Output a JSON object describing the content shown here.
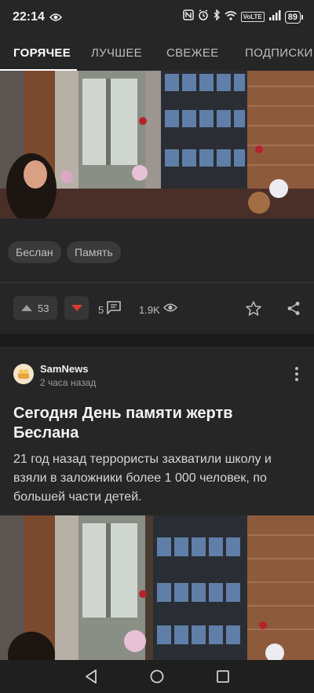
{
  "status": {
    "time": "22:14",
    "volte": "VoLTE",
    "battery": "89"
  },
  "tabs": [
    {
      "label": "ГОРЯЧЕЕ",
      "active": true
    },
    {
      "label": "ЛУЧШЕЕ",
      "active": false
    },
    {
      "label": "СВЕЖЕЕ",
      "active": false
    },
    {
      "label": "ПОДПИСКИ",
      "active": false
    }
  ],
  "post1": {
    "tags": [
      "Беслан",
      "Память"
    ],
    "votes": "53",
    "comments": "5",
    "views": "1.9K"
  },
  "post2": {
    "author": "SamNews",
    "time_ago": "2 часа назад",
    "title": "Сегодня День памяти жертв Беслана",
    "text": "21 год назад террористы захватили школу и взяли в заложники более 1 000 человек, по большей части детей."
  },
  "colors": {
    "background": "#262626",
    "downvote": "#e0392b",
    "tab_active": "#ffffff"
  },
  "icons": [
    "eye-icon",
    "nfc-icon",
    "alarm-icon",
    "bluetooth-icon",
    "wifi-icon",
    "signal-icon",
    "battery-icon",
    "upvote-arrow-icon",
    "downvote-arrow-icon",
    "comment-icon",
    "views-eye-icon",
    "star-icon",
    "share-icon",
    "more-vert-icon",
    "back-icon",
    "home-icon",
    "recents-icon"
  ]
}
